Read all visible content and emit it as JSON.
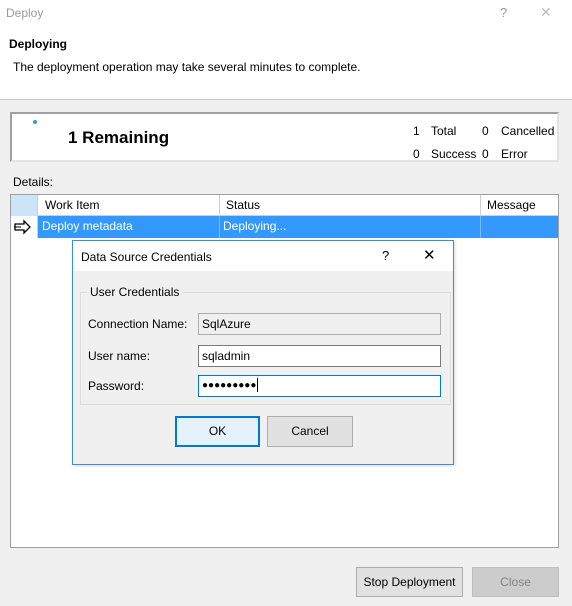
{
  "window": {
    "title": "Deploy",
    "help_glyph": "?",
    "close_glyph": "✕"
  },
  "header": {
    "heading": "Deploying",
    "description": "The deployment operation may take several minutes to complete."
  },
  "summary": {
    "remaining": "1 Remaining",
    "total_count": "1",
    "total_label": "Total",
    "cancelled_count": "0",
    "cancelled_label": "Cancelled",
    "success_count": "0",
    "success_label": "Success",
    "error_count": "0",
    "error_label": "Error"
  },
  "details": {
    "label": "Details:",
    "columns": [
      "Work Item",
      "Status",
      "Message"
    ],
    "rows": [
      {
        "work_item": "Deploy metadata",
        "status": "Deploying...",
        "message": ""
      }
    ]
  },
  "dialog": {
    "title": "Data Source Credentials",
    "help_glyph": "?",
    "close_glyph": "✕",
    "group_label": "User Credentials",
    "connection_name_label": "Connection Name:",
    "connection_name_value": "SqlAzure",
    "username_label": "User name:",
    "username_value": "sqladmin",
    "password_label": "Password:",
    "password_mask": "●●●●●●●●●",
    "ok_label": "OK",
    "cancel_label": "Cancel"
  },
  "footer": {
    "stop_label": "Stop Deployment",
    "close_label": "Close"
  },
  "colors": {
    "selection": "#3399ff",
    "accent": "#0078d7",
    "dialog_border": "#3b8ed8"
  }
}
